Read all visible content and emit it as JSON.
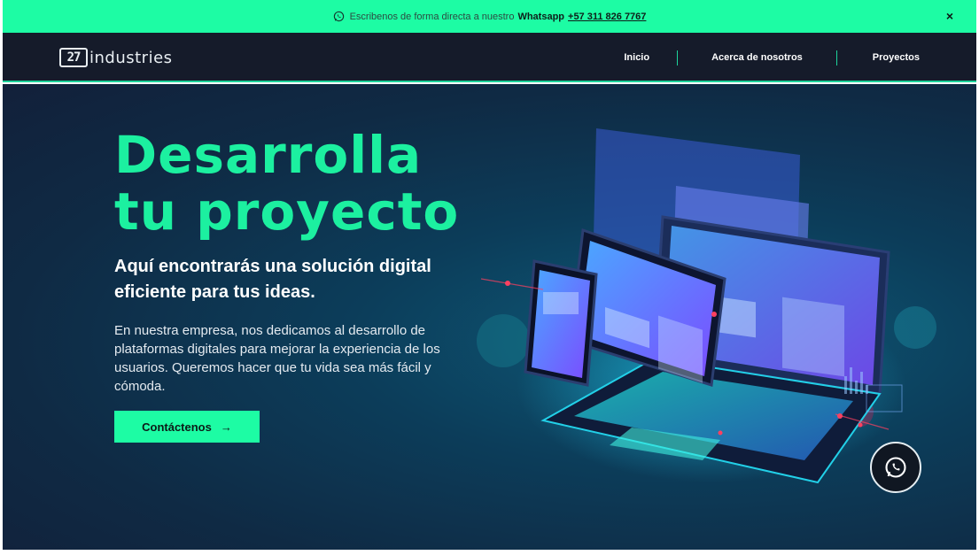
{
  "banner": {
    "text_prefix": "Escribenos de forma directa a nuestro",
    "text_bold": "Whatsapp",
    "phone": "+57 311 826 7767",
    "close_symbol": "×"
  },
  "header": {
    "logo_mark": "27",
    "logo_text": "industries",
    "nav": [
      {
        "label": "Inicio"
      },
      {
        "label": "Acerca de nosotros"
      },
      {
        "label": "Proyectos"
      }
    ]
  },
  "hero": {
    "title": "Desarrolla\ntu proyecto",
    "subtitle": "Aquí encontrarás una solución digital\neficiente para tus ideas.",
    "body": "En nuestra empresa, nos dedicamos al desarrollo de\nplataformas digitales para mejorar la experiencia de los\nusuarios. Queremos hacer que tu vida sea más fácil y\ncómoda.",
    "cta_label": "Contáctenos",
    "cta_arrow": "→"
  },
  "colors": {
    "accent": "#1dfca4",
    "header_bg": "#151b2a",
    "hero_bg": "#0c3d5a"
  },
  "icons": {
    "banner_icon": "whatsapp-icon",
    "fab_icon": "whatsapp-icon",
    "illustration": "devices-illustration"
  }
}
